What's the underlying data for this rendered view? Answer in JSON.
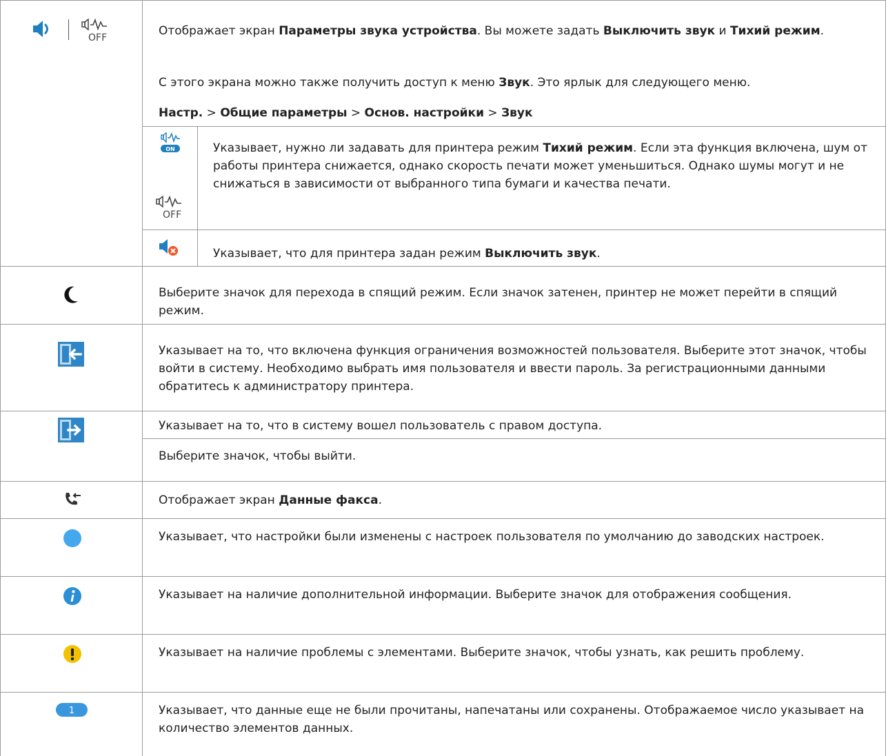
{
  "rows": {
    "sound": {
      "intro_parts": [
        {
          "t": "Отображает экран ",
          "b": false
        },
        {
          "t": "Параметры звука устройства",
          "b": true
        },
        {
          "t": ". Вы можете задать ",
          "b": false
        },
        {
          "t": "Выключить звук",
          "b": true
        },
        {
          "t": " и ",
          "b": false
        },
        {
          "t": "Тихий режим",
          "b": true
        },
        {
          "t": ".",
          "b": false
        }
      ],
      "menu_access_parts": [
        {
          "t": "С этого экрана можно также получить доступ к меню ",
          "b": false
        },
        {
          "t": "Звук",
          "b": true
        },
        {
          "t": ". Это ярлык для следующего меню.",
          "b": false
        }
      ],
      "menu_path_parts": [
        {
          "t": "Настр.",
          "b": true
        },
        {
          "t": " > ",
          "b": false
        },
        {
          "t": "Общие параметры",
          "b": true
        },
        {
          "t": " > ",
          "b": false
        },
        {
          "t": "Основ. настройки",
          "b": true
        },
        {
          "t": " > ",
          "b": false
        },
        {
          "t": "Звук",
          "b": true
        }
      ],
      "quiet_parts": [
        {
          "t": "Указывает, нужно ли задавать для принтера режим ",
          "b": false
        },
        {
          "t": "Тихий режим",
          "b": true
        },
        {
          "t": ". Если эта функция включена, шум от работы принтера снижается, однако скорость печати может уменьшиться. Однако шумы могут и не снижаться в зависимости от выбранного типа бумаги и качества печати.",
          "b": false
        }
      ],
      "mute_parts": [
        {
          "t": "Указывает, что для принтера задан режим ",
          "b": false
        },
        {
          "t": "Выключить звук",
          "b": true
        },
        {
          "t": ".",
          "b": false
        }
      ],
      "on_badge": "ON",
      "off_badge": "OFF"
    },
    "sleep": {
      "text": "Выберите значок для перехода в спящий режим. Если значок затенен, принтер не может перейти в спящий режим."
    },
    "login": {
      "text": "Указывает на то, что включена функция ограничения возможностей пользователя. Выберите этот значок, чтобы войти в систему. Необходимо выбрать имя пользователя и ввести пароль. За регистрационными данными обратитесь к администратору принтера."
    },
    "logout": {
      "text1": "Указывает на то, что в систему вошел пользователь с правом доступа.",
      "text2": "Выберите значок, чтобы выйти."
    },
    "fax": {
      "parts": [
        {
          "t": "Отображает экран ",
          "b": false
        },
        {
          "t": "Данные факса",
          "b": true
        },
        {
          "t": ".",
          "b": false
        }
      ]
    },
    "changed": {
      "text": "Указывает, что настройки были изменены с настроек пользователя по умолчанию до заводских настроек."
    },
    "info": {
      "text": "Указывает на наличие дополнительной информации. Выберите значок для отображения сообщения."
    },
    "warning": {
      "text": "Указывает на наличие проблемы с элементами. Выберите значок, чтобы узнать, как решить проблему."
    },
    "unread": {
      "badge": "1",
      "text": "Указывает, что данные еще не были прочитаны, напечатаны или сохранены. Отображаемое число указывает на количество элементов данных."
    }
  },
  "colors": {
    "border": "#9a9a9a",
    "icon_blue": "#1f7fc0",
    "login_blue": "#2f86c6",
    "info_blue": "#2a8fd6",
    "dot_blue": "#45a8ef",
    "warning_yellow": "#f2c200",
    "mute_orange": "#f0562a"
  },
  "icons": [
    "speaker-icon",
    "quiet-mode-off-icon",
    "quiet-mode-on-icon",
    "mute-icon",
    "moon-icon",
    "login-icon",
    "logout-icon",
    "fax-data-icon",
    "changed-dot-icon",
    "info-icon",
    "warning-icon",
    "unread-count-icon"
  ]
}
